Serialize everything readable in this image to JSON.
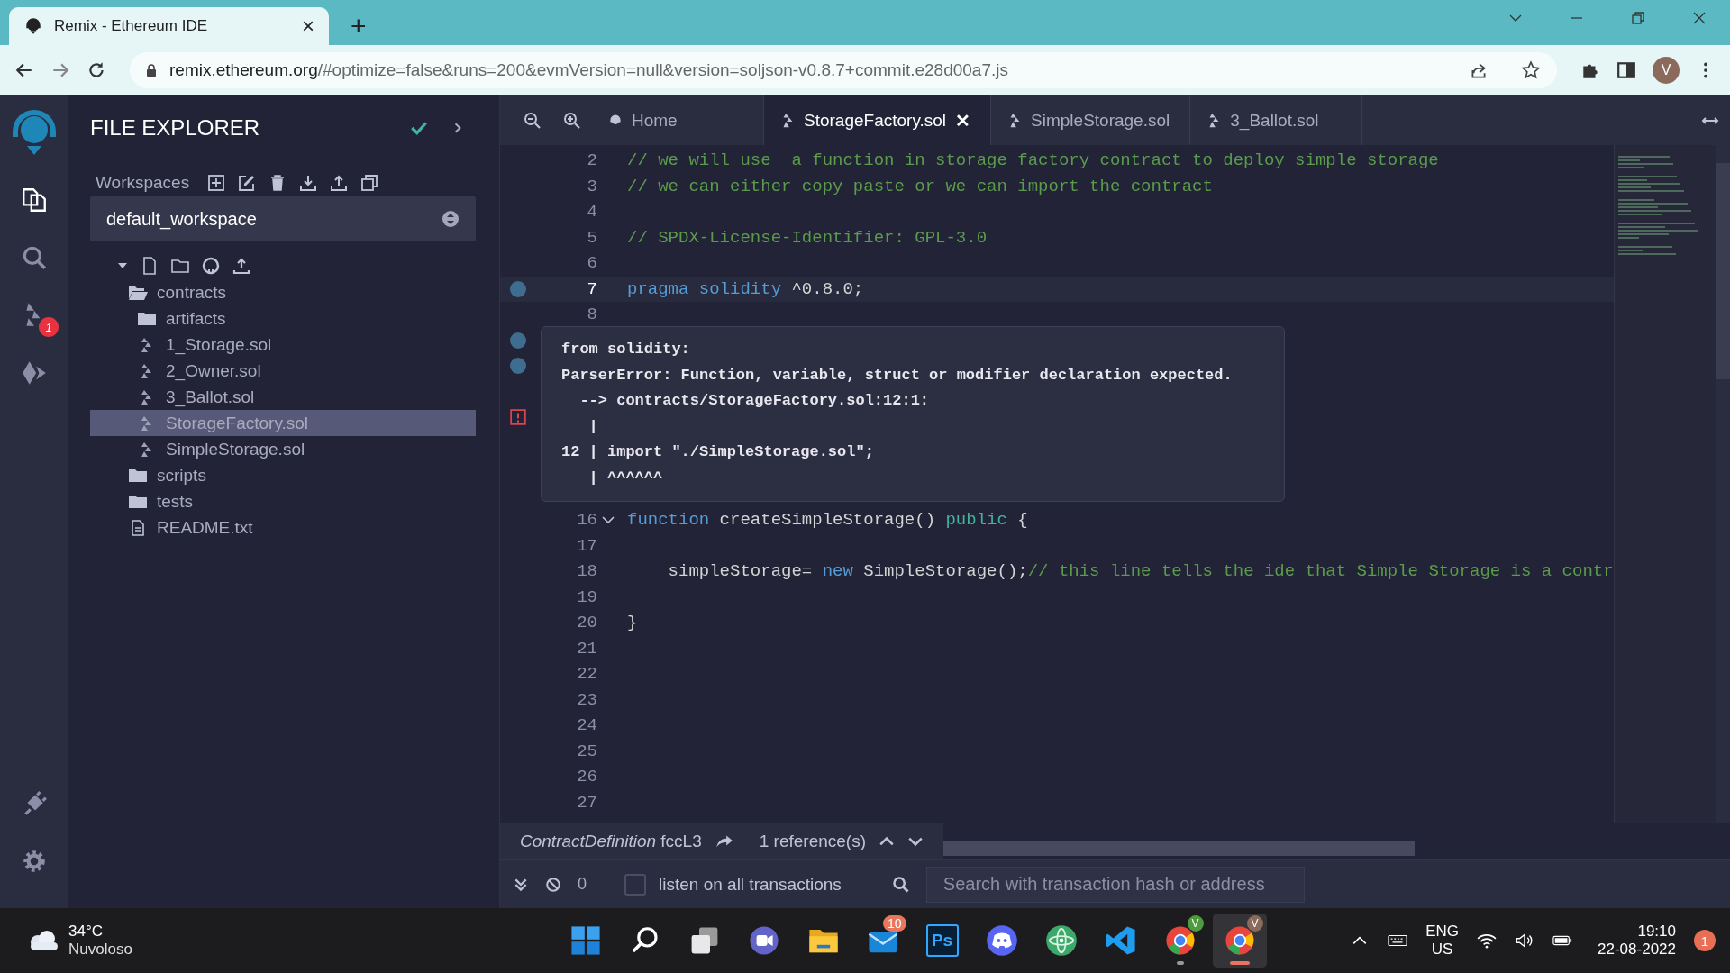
{
  "browser": {
    "tab_title": "Remix - Ethereum IDE",
    "tab_close": "×",
    "new_tab": "+",
    "url_host": "remix.ethereum.org",
    "url_rest": "/#optimize=false&runs=200&evmVersion=null&version=soljson-v0.8.7+commit.e28d00a7.js",
    "profile": "V"
  },
  "activity_bar": {
    "items": [
      {
        "kind": "files",
        "selected": true
      },
      {
        "kind": "search",
        "selected": false
      },
      {
        "kind": "solidity",
        "selected": false,
        "badge": "1"
      },
      {
        "kind": "deploy",
        "selected": false
      }
    ],
    "bottom_items": [
      {
        "kind": "plugin"
      },
      {
        "kind": "settings"
      }
    ]
  },
  "explorer": {
    "title": "FILE EXPLORER",
    "workspaces_label": "Workspaces",
    "workspace": "default_workspace",
    "tree": [
      {
        "name": "contracts",
        "kind": "folder",
        "expanded": true,
        "selected": false,
        "children": [
          {
            "name": "artifacts",
            "kind": "folder",
            "expanded": false,
            "selected": false
          },
          {
            "name": "1_Storage.sol",
            "kind": "sol",
            "selected": false
          },
          {
            "name": "2_Owner.sol",
            "kind": "sol",
            "selected": false
          },
          {
            "name": "3_Ballot.sol",
            "kind": "sol",
            "selected": false
          },
          {
            "name": "StorageFactory.sol",
            "kind": "sol",
            "selected": true
          },
          {
            "name": "SimpleStorage.sol",
            "kind": "sol",
            "selected": false
          }
        ]
      },
      {
        "name": "scripts",
        "kind": "folder",
        "expanded": false,
        "selected": false
      },
      {
        "name": "tests",
        "kind": "folder",
        "expanded": false,
        "selected": false
      },
      {
        "name": "README.txt",
        "kind": "txt",
        "selected": false
      }
    ]
  },
  "editor": {
    "tabs": [
      {
        "label": "Home",
        "kind": "home",
        "selected": false
      },
      {
        "label": "StorageFactory.sol",
        "kind": "sol",
        "selected": true,
        "close": "✕"
      },
      {
        "label": "SimpleStorage.sol",
        "kind": "sol",
        "selected": false
      },
      {
        "label": "3_Ballot.sol",
        "kind": "sol",
        "selected": false
      }
    ],
    "lines": [
      {
        "number": "2",
        "current": false,
        "breakpoint": false,
        "error": false,
        "tokens": [
          {
            "kind": "comment",
            "text": "// we will use  a function in storage factory contract to deploy simple storage"
          }
        ]
      },
      {
        "number": "3",
        "current": false,
        "breakpoint": false,
        "error": false,
        "tokens": [
          {
            "kind": "comment",
            "text": "// we can either copy paste or we can import the contract"
          }
        ]
      },
      {
        "number": "4",
        "current": false,
        "breakpoint": false,
        "error": false
      },
      {
        "number": "5",
        "current": false,
        "breakpoint": false,
        "error": false,
        "tokens": [
          {
            "kind": "comment",
            "text": "// SPDX-License-Identifier: GPL-3.0"
          }
        ]
      },
      {
        "number": "6",
        "current": false,
        "breakpoint": false,
        "error": false
      },
      {
        "number": "7",
        "current": true,
        "breakpoint": true,
        "error": false,
        "tokens": [
          {
            "kind": "keyword",
            "text": "pragma"
          },
          {
            "kind": "keyword",
            "text": " solidity"
          },
          {
            "kind": "plain",
            "text": " ^0.8.0;"
          }
        ]
      },
      {
        "number": "8",
        "current": false,
        "breakpoint": false,
        "error": false
      },
      {
        "breakpoint": true,
        "error": false
      },
      {
        "breakpoint": true,
        "error": false
      },
      {
        "breakpoint": false,
        "error": false
      },
      {
        "breakpoint": false,
        "error": true
      },
      {
        "breakpoint": false,
        "error": false
      },
      {
        "breakpoint": false,
        "error": false
      },
      {
        "breakpoint": false,
        "error": false
      },
      {
        "number": "16",
        "current": false,
        "breakpoint": false,
        "error": false,
        "fold": true,
        "tokens": [
          {
            "kind": "keyword",
            "text": "function"
          },
          {
            "kind": "plain",
            "text": " createSimpleStorage() "
          },
          {
            "kind": "modifier",
            "text": "public"
          },
          {
            "kind": "plain",
            "text": " {"
          }
        ]
      },
      {
        "number": "17",
        "current": false,
        "breakpoint": false,
        "error": false
      },
      {
        "number": "18",
        "current": false,
        "breakpoint": false,
        "error": false,
        "tokens": [
          {
            "kind": "plain",
            "text": "    simpleStorage= "
          },
          {
            "kind": "keyword",
            "text": "new"
          },
          {
            "kind": "plain",
            "text": " SimpleStorage();"
          },
          {
            "kind": "comment",
            "text": "// this line tells the ide that Simple Storage is a contr"
          }
        ]
      },
      {
        "number": "19",
        "current": false,
        "breakpoint": false,
        "error": false
      },
      {
        "number": "20",
        "current": false,
        "breakpoint": false,
        "error": false,
        "tokens": [
          {
            "kind": "plain",
            "text": "}"
          }
        ]
      },
      {
        "number": "21",
        "current": false,
        "breakpoint": false,
        "error": false
      },
      {
        "number": "22",
        "current": false,
        "breakpoint": false,
        "error": false
      },
      {
        "number": "23",
        "current": false,
        "breakpoint": false,
        "error": false
      },
      {
        "number": "24",
        "current": false,
        "breakpoint": false,
        "error": false
      },
      {
        "number": "25",
        "current": false,
        "breakpoint": false,
        "error": false
      },
      {
        "number": "26",
        "current": false,
        "breakpoint": false,
        "error": false
      },
      {
        "number": "27",
        "current": false,
        "breakpoint": false,
        "error": false
      }
    ],
    "tooltip": [
      "from solidity:",
      "ParserError: Function, variable, struct or modifier declaration expected.",
      "  --> contracts/StorageFactory.sol:12:1:",
      "   |",
      "12 | import \"./SimpleStorage.sol\";",
      "   | ^^^^^^"
    ],
    "reference_bar": {
      "definition": "ContractDefinition",
      "name": "fccL3",
      "references": "1 reference(s)"
    }
  },
  "terminal": {
    "count": "0",
    "listen_label": "listen on all transactions",
    "listen_checked": false,
    "search_placeholder": "Search with transaction hash or address"
  },
  "taskbar": {
    "weather_temp": "34°C",
    "weather_text": "Nuvoloso",
    "apps": [
      {
        "kind": "start",
        "running": false,
        "selected": false
      },
      {
        "kind": "search",
        "running": false,
        "selected": false
      },
      {
        "kind": "taskview",
        "running": false,
        "selected": false
      },
      {
        "kind": "chat",
        "running": false,
        "selected": false
      },
      {
        "kind": "folder",
        "running": false,
        "selected": false
      },
      {
        "kind": "mail",
        "running": false,
        "selected": false,
        "badge": "10"
      },
      {
        "kind": "ps",
        "label": "Ps",
        "running": false,
        "selected": false
      },
      {
        "kind": "discord",
        "running": false,
        "selected": false
      },
      {
        "kind": "atom",
        "running": false,
        "selected": false
      },
      {
        "kind": "vscode",
        "running": false,
        "selected": false
      },
      {
        "kind": "chrome",
        "running": true,
        "selected": false,
        "profile": "V",
        "color": "#4e9a3f"
      },
      {
        "kind": "chrome",
        "running": true,
        "selected": true,
        "profile": "V",
        "color": "#8b6a5c"
      }
    ],
    "lang_top": "ENG",
    "lang_bottom": "US",
    "time": "19:10",
    "date": "22-08-2022",
    "notifications": "1"
  }
}
